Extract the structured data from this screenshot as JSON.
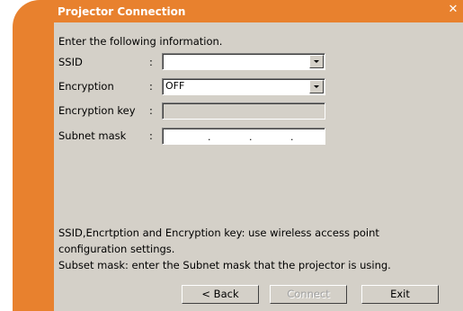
{
  "window": {
    "title": "Projector Connection",
    "close_icon": "close-icon"
  },
  "form": {
    "intro": "Enter the following information.",
    "fields": [
      {
        "label": "SSID",
        "type": "dropdown",
        "value": ""
      },
      {
        "label": "Encryption",
        "type": "dropdown",
        "value": "OFF"
      },
      {
        "label": "Encryption key",
        "type": "text",
        "value": "",
        "disabled": true
      },
      {
        "label": "Subnet mask",
        "type": "ip",
        "separators": [
          ".",
          ".",
          "."
        ]
      }
    ],
    "colon": ":"
  },
  "help": {
    "line1": "SSID,Encrtption and Encryption key: use wireless access point",
    "line2": "configuration settings.",
    "line3": "Subset mask: enter the Subnet mask that the projector is using."
  },
  "buttons": {
    "back": "< Back",
    "connect": "Connect",
    "exit": "Exit"
  },
  "colors": {
    "accent": "#e8812e",
    "dialog_bg": "#d4d0c8"
  }
}
